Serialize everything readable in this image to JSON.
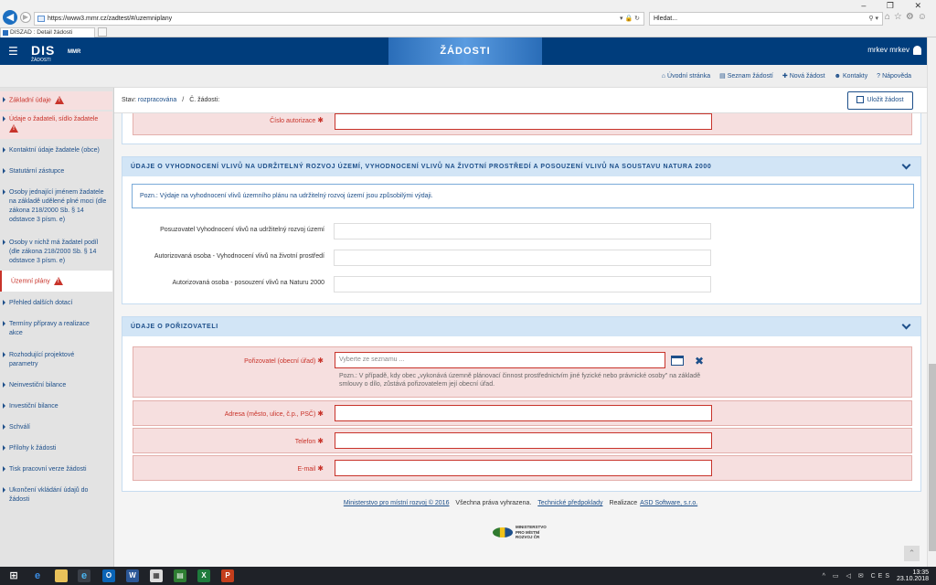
{
  "browser": {
    "url": "https://www3.mmr.cz/zadtest/#/uzemniplany",
    "search_placeholder": "Hledat...",
    "tab_title": "DISZAD : Detail žádosti"
  },
  "header": {
    "logo": "DIS",
    "logo_sub": "ŽÁDOSTI",
    "logo_mmr": "MMR",
    "banner_title": "ŽÁDOSTI",
    "user_name": "mrkev mrkev"
  },
  "topnav": {
    "items": [
      "Úvodní stránka",
      "Seznam žádostí",
      "Nová žádost",
      "Kontakty",
      "Nápověda"
    ]
  },
  "sidebar": {
    "items": [
      {
        "label": "Základní údaje",
        "error": true
      },
      {
        "label": "Údaje o žadateli, sídlo žadatele",
        "error": true
      },
      {
        "label": "Kontaktní údaje žadatele (obce)",
        "error": false
      },
      {
        "label": "Statutární zástupce",
        "error": false
      },
      {
        "label": "Osoby jednající jménem žadatele na základě udělené plné moci (dle zákona 218/2000 Sb. § 14 odstavce 3 písm. e)",
        "error": false
      },
      {
        "label": "Osoby v nichž má žadatel podíl (dle zákona 218/2000 Sb. § 14 odstavce 3 písm. e)",
        "error": false
      },
      {
        "label": "Územní plány",
        "error": true
      },
      {
        "label": "Přehled dalších dotací",
        "error": false
      },
      {
        "label": "Termíny přípravy a realizace akce",
        "error": false
      },
      {
        "label": "Rozhodující projektové parametry",
        "error": false
      },
      {
        "label": "Neinvestiční bilance",
        "error": false
      },
      {
        "label": "Investiční bilance",
        "error": false
      },
      {
        "label": "Schválí",
        "error": false
      },
      {
        "label": "Přílohy k žádosti",
        "error": false
      },
      {
        "label": "Tisk pracovní verze žádosti",
        "error": false
      },
      {
        "label": "Ukončení vkládání údajů do žádosti",
        "error": false
      }
    ]
  },
  "subbar": {
    "status_label": "Stav:",
    "status_value": "rozpracována",
    "separator": "/",
    "number_label": "Č. žádosti:",
    "save_label": "Uložit žádost"
  },
  "sections": {
    "authorization": {
      "label": "Číslo autorizace"
    },
    "impact": {
      "title": "Údaje o vyhodnocení vlivů na udržitelný rozvoj území, vyhodnocení vlivů na životní prostředí a posouzení vlivů na soustavu Natura 2000",
      "note": "Pozn.: Výdaje na vyhodnocení vlivů územního plánu na udržitelný rozvoj území jsou způsobilými výdaji.",
      "fields": [
        {
          "label": "Posuzovatel Vyhodnocení vlivů na udržitelný rozvoj území"
        },
        {
          "label": "Autorizovaná osoba - Vyhodnocení vlivů na životní prostředí"
        },
        {
          "label": "Autorizovaná osoba - posouzení vlivů na Naturu 2000"
        }
      ]
    },
    "procurer": {
      "title": "Údaje o pořizovateli",
      "procurer_label": "Pořizovatel (obecní úřad)",
      "procurer_placeholder": "Vyberte ze seznamu ...",
      "procurer_hint": "Pozn.: V případě, kdy obec „vykonává územně plánovací činnost prostřednictvím jiné fyzické nebo právnické osoby\" na základě smlouvy o dílo, zůstává pořizovatelem její obecní úřad.",
      "address_label": "Adresa (město, ulice, č.p., PSČ)",
      "phone_label": "Telefon",
      "email_label": "E-mail"
    }
  },
  "footer": {
    "ministry_link": "Ministerstvo pro místní rozvoj © 2016",
    "rights": "Všechna práva vyhrazena.",
    "tech_link": "Technické předpoklady",
    "realization_label": "Realizace",
    "realization_link": "ASD Software, s.r.o.",
    "logo_text_1": "MINISTERSTVO",
    "logo_text_2": "PRO MÍSTNÍ",
    "logo_text_3": "ROZVOJ ČR"
  },
  "taskbar": {
    "lang": "CES",
    "time": "13:35",
    "date": "23.10.2018"
  },
  "colors": {
    "brand": "#003d7c",
    "link": "#1d4f8a",
    "error": "#c8332a",
    "error_bg": "#f6dfdf",
    "panel_head": "#d2e5f6"
  }
}
